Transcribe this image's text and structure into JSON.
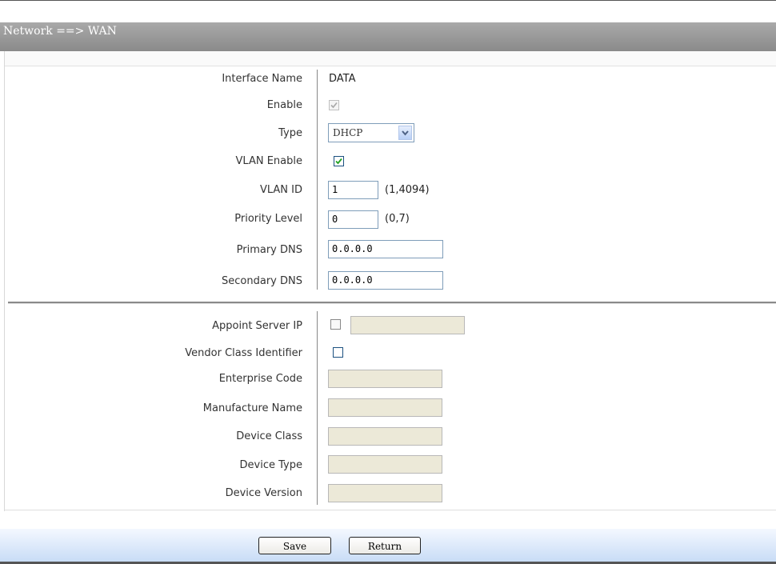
{
  "header": {
    "breadcrumb": "Network ==> WAN"
  },
  "form": {
    "interface_name": {
      "label": "Interface Name",
      "value": "DATA"
    },
    "enable": {
      "label": "Enable",
      "checked": true
    },
    "type": {
      "label": "Type",
      "value": "DHCP"
    },
    "vlan_enable": {
      "label": "VLAN Enable",
      "checked": true
    },
    "vlan_id": {
      "label": "VLAN ID",
      "value": "1",
      "hint": "(1,4094)"
    },
    "priority_level": {
      "label": "Priority Level",
      "value": "0",
      "hint": "(0,7)"
    },
    "primary_dns": {
      "label": "Primary DNS",
      "value": "0.0.0.0"
    },
    "secondary_dns": {
      "label": "Secondary DNS",
      "value": "0.0.0.0"
    },
    "appoint_server_ip": {
      "label": "Appoint Server IP",
      "checked": false,
      "value": ""
    },
    "vendor_class_identifier": {
      "label": "Vendor Class Identifier",
      "checked": false
    },
    "enterprise_code": {
      "label": "Enterprise Code",
      "value": ""
    },
    "manufacture_name": {
      "label": "Manufacture Name",
      "value": ""
    },
    "device_class": {
      "label": "Device Class",
      "value": ""
    },
    "device_type": {
      "label": "Device Type",
      "value": ""
    },
    "device_version": {
      "label": "Device Version",
      "value": ""
    }
  },
  "buttons": {
    "save": "Save",
    "return": "Return"
  }
}
